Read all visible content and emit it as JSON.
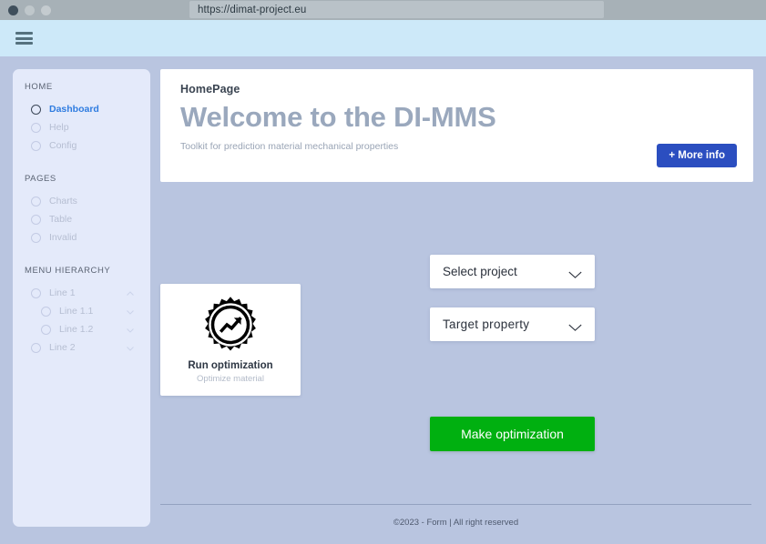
{
  "browser": {
    "url": "https://dimat-project.eu",
    "window_controls": [
      "close",
      "minimize",
      "maximize"
    ]
  },
  "navbar": {
    "menu_icon": "hamburger-icon"
  },
  "sidebar": {
    "sections": [
      {
        "title": "HOME",
        "items": [
          {
            "label": "Dashboard",
            "active": true
          },
          {
            "label": "Help",
            "active": false
          },
          {
            "label": "Config",
            "active": false
          }
        ]
      },
      {
        "title": "PAGES",
        "items": [
          {
            "label": "Charts",
            "active": false
          },
          {
            "label": "Table",
            "active": false
          },
          {
            "label": "Invalid",
            "active": false
          }
        ]
      },
      {
        "title": "MENU HIERARCHY",
        "items": [
          {
            "label": "Line 1",
            "chevron": "chevron-up",
            "indent": false
          },
          {
            "label": "Line 1.1",
            "chevron": "chevron-down",
            "indent": true
          },
          {
            "label": "Line 1.2",
            "chevron": "chevron-down",
            "indent": true
          },
          {
            "label": "Line 2",
            "chevron": "chevron-down",
            "indent": false
          }
        ]
      }
    ]
  },
  "hero": {
    "eyebrow": "HomePage",
    "title": "Welcome to the DI-MMS",
    "subtitle": "Toolkit for prediction material mechanical properties",
    "more_info_label": "+ More info"
  },
  "run_card": {
    "icon": "gear-chart-icon",
    "title": "Run optimization",
    "subtitle": "Optimize material"
  },
  "form": {
    "select_project": {
      "value": "Select project",
      "chevron": "chevron-down-icon"
    },
    "target_property": {
      "value": "Target  property",
      "chevron": "chevron-down-icon"
    },
    "submit_label": "Make optimization"
  },
  "footer": {
    "text": "©2023 - Form |  All right reserved"
  },
  "colors": {
    "page_background": "#b9c5e0",
    "sidebar_background": "#e4eafa",
    "navbar_background": "#cde9f9",
    "titlebar_background": "#a7b1b7",
    "accent_blue": "#2b4ec0",
    "active_nav_blue": "#2f7ce0",
    "submit_green": "#00b010",
    "hero_title_gray": "#9aa8bd"
  }
}
